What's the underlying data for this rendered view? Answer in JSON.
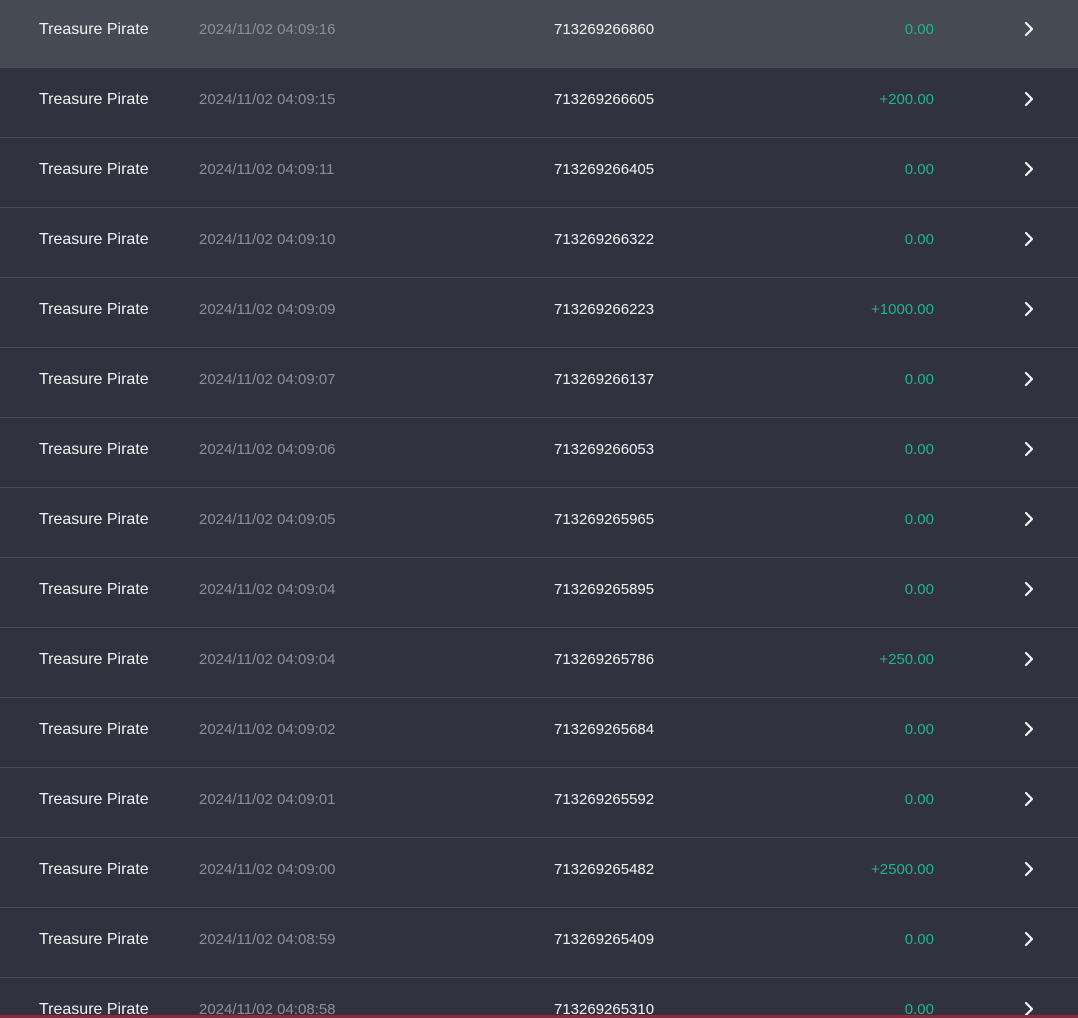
{
  "colors": {
    "row_bg": "#303240",
    "row_highlight_bg": "#454a54",
    "divider": "#4a4d57",
    "amount_green": "#20b48a",
    "muted_text": "#8b8e96"
  },
  "records": [
    {
      "game": "Treasure Pirate",
      "time": "2024/11/02 04:09:16",
      "order_id": "713269266860",
      "amount": "0.00",
      "icon": "chevron-right-icon"
    },
    {
      "game": "Treasure Pirate",
      "time": "2024/11/02 04:09:15",
      "order_id": "713269266605",
      "amount": "+200.00",
      "icon": "chevron-right-icon"
    },
    {
      "game": "Treasure Pirate",
      "time": "2024/11/02 04:09:11",
      "order_id": "713269266405",
      "amount": "0.00",
      "icon": "chevron-right-icon"
    },
    {
      "game": "Treasure Pirate",
      "time": "2024/11/02 04:09:10",
      "order_id": "713269266322",
      "amount": "0.00",
      "icon": "chevron-right-icon"
    },
    {
      "game": "Treasure Pirate",
      "time": "2024/11/02 04:09:09",
      "order_id": "713269266223",
      "amount": "+1000.00",
      "icon": "chevron-right-icon"
    },
    {
      "game": "Treasure Pirate",
      "time": "2024/11/02 04:09:07",
      "order_id": "713269266137",
      "amount": "0.00",
      "icon": "chevron-right-icon"
    },
    {
      "game": "Treasure Pirate",
      "time": "2024/11/02 04:09:06",
      "order_id": "713269266053",
      "amount": "0.00",
      "icon": "chevron-right-icon"
    },
    {
      "game": "Treasure Pirate",
      "time": "2024/11/02 04:09:05",
      "order_id": "713269265965",
      "amount": "0.00",
      "icon": "chevron-right-icon"
    },
    {
      "game": "Treasure Pirate",
      "time": "2024/11/02 04:09:04",
      "order_id": "713269265895",
      "amount": "0.00",
      "icon": "chevron-right-icon"
    },
    {
      "game": "Treasure Pirate",
      "time": "2024/11/02 04:09:04",
      "order_id": "713269265786",
      "amount": "+250.00",
      "icon": "chevron-right-icon"
    },
    {
      "game": "Treasure Pirate",
      "time": "2024/11/02 04:09:02",
      "order_id": "713269265684",
      "amount": "0.00",
      "icon": "chevron-right-icon"
    },
    {
      "game": "Treasure Pirate",
      "time": "2024/11/02 04:09:01",
      "order_id": "713269265592",
      "amount": "0.00",
      "icon": "chevron-right-icon"
    },
    {
      "game": "Treasure Pirate",
      "time": "2024/11/02 04:09:00",
      "order_id": "713269265482",
      "amount": "+2500.00",
      "icon": "chevron-right-icon"
    },
    {
      "game": "Treasure Pirate",
      "time": "2024/11/02 04:08:59",
      "order_id": "713269265409",
      "amount": "0.00",
      "icon": "chevron-right-icon"
    },
    {
      "game": "Treasure Pirate",
      "time": "2024/11/02 04:08:58",
      "order_id": "713269265310",
      "amount": "0.00",
      "icon": "chevron-right-icon"
    }
  ]
}
